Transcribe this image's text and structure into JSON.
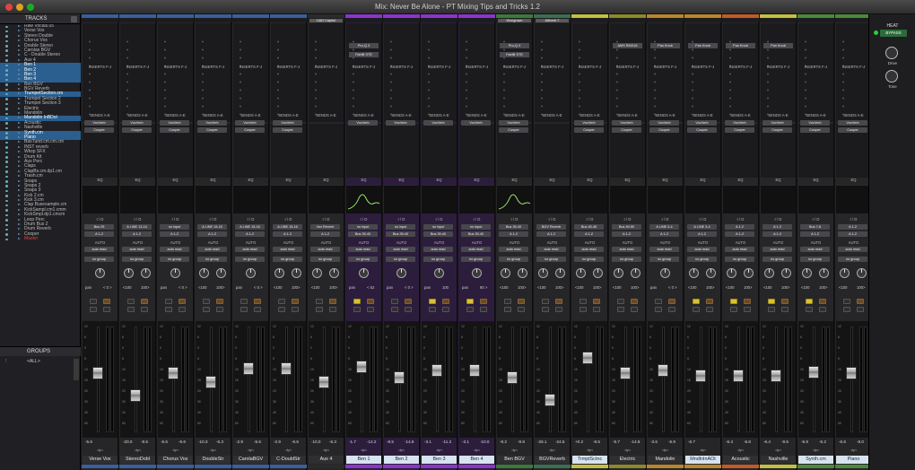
{
  "window": {
    "title": "Mix: Never Be Alone - PT Mixing Tips and Tricks 1.2"
  },
  "tracks_panel": {
    "header": "TRACKS",
    "items": [
      {
        "name": "Raw Vocals.05",
        "sel": false
      },
      {
        "name": "Verse Vox",
        "sel": false
      },
      {
        "name": "Stereo Double",
        "sel": false
      },
      {
        "name": "Chorus Vox",
        "sel": false
      },
      {
        "name": "Double Stereo",
        "sel": false
      },
      {
        "name": "Carolas BGV",
        "sel": false
      },
      {
        "name": "C - Double Stereo",
        "sel": false
      },
      {
        "name": "Aux 4",
        "sel": false
      },
      {
        "name": "Ben 1",
        "sel": true
      },
      {
        "name": "Ben 2",
        "sel": true
      },
      {
        "name": "Ben 3",
        "sel": true
      },
      {
        "name": "Ben 4",
        "sel": true
      },
      {
        "name": "Ben BGV",
        "sel": false
      },
      {
        "name": "BGV Reverb",
        "sel": false
      },
      {
        "name": "TrumpetSection.cm",
        "sel": true
      },
      {
        "name": "Trumpet Section 2",
        "sel": false
      },
      {
        "name": "Trumpet Section 3",
        "sel": false
      },
      {
        "name": "Electric",
        "sel": false
      },
      {
        "name": "Mandolin",
        "sel": false
      },
      {
        "name": "Mandolin InBDol",
        "sel": true
      },
      {
        "name": "Acoustic",
        "sel": false
      },
      {
        "name": "Nashville",
        "sel": false
      },
      {
        "name": "Synth.cm",
        "sel": true
      },
      {
        "name": "Piano",
        "sel": true
      },
      {
        "name": "BasTund.cm.cm.cm",
        "sel": false
      },
      {
        "name": "INST reverb",
        "sel": false
      },
      {
        "name": "Wksp SFX",
        "sel": false
      },
      {
        "name": "Drum Kit",
        "sel": false
      },
      {
        "name": "Aux Perc",
        "sel": false
      },
      {
        "name": "Claps",
        "sel": false
      },
      {
        "name": "ClapBs.cm.dp1.cm",
        "sel": false
      },
      {
        "name": "Trash.cm",
        "sel": false
      },
      {
        "name": "Snaps",
        "sel": false
      },
      {
        "name": "Snaps 2",
        "sel": false
      },
      {
        "name": "Snaps 3",
        "sel": false
      },
      {
        "name": "Kick 2.cm",
        "sel": false
      },
      {
        "name": "Kick 3.cm",
        "sel": false
      },
      {
        "name": "Clap Busesample.cm",
        "sel": false
      },
      {
        "name": "KickSampl.cm1.cmm",
        "sel": false
      },
      {
        "name": "KickSmpl.dp1.cmcm",
        "sel": false
      },
      {
        "name": "Loop Perc",
        "sel": false
      },
      {
        "name": "Drum Bus 2",
        "sel": false
      },
      {
        "name": "Drum Reverb",
        "sel": false
      },
      {
        "name": "Cooper",
        "sel": false
      },
      {
        "name": "Master",
        "sel": false,
        "red": true
      }
    ]
  },
  "groups_panel": {
    "header": "GROUPS",
    "items": [
      {
        "mark": "!",
        "name": "<ALL>"
      }
    ]
  },
  "labels": {
    "inserts": "INSERTS F-J",
    "sends": "SENDS A-E",
    "eq": "EQ",
    "io": "I / O",
    "auto": "AUTO",
    "no_group": "no group",
    "pan": "pan",
    "dyn": "dyn",
    "vol_default": "vol"
  },
  "strips": [
    {
      "name": "Verse Vox",
      "color": "#3a5f9e",
      "plugs": [],
      "send1": "VocVerb",
      "send2": "Cooper",
      "out": "Bus 25",
      "in": "A 1-2",
      "auto": "auto read",
      "pan_l": "pan",
      "pan_v": "< 0 >",
      "vol": "-5.6",
      "peak": "",
      "fader": 0.55,
      "sm": [
        "g",
        "o"
      ]
    },
    {
      "name": "StereoDobl",
      "color": "#3a5f9e",
      "plugs": [],
      "send1": "VocVerb",
      "send2": "Cooper",
      "out": "A LINE 13-14",
      "in": "A 1-2",
      "auto": "auto read",
      "pan_l": "<100",
      "pan_v": "100>",
      "vol": "-20.0",
      "peak": "-8.6",
      "fader": 0.3,
      "sm": [
        "g",
        "o"
      ]
    },
    {
      "name": "Chorus Vox",
      "color": "#3a5f9e",
      "plugs": [],
      "send1": "VocVerb",
      "send2": "Cooper",
      "out": "no input",
      "in": "A 1-2",
      "auto": "auto read",
      "pan_l": "pan",
      "pan_v": "< 0 >",
      "vol": "-6.6",
      "peak": "-6.6",
      "fader": 0.55,
      "sm": [
        "g",
        "o"
      ]
    },
    {
      "name": "DoubleStr",
      "color": "#3a5f9e",
      "plugs": [],
      "send1": "VocVerb",
      "send2": "Cooper",
      "out": "A LINE 15-16",
      "in": "A 1-2",
      "auto": "auto read",
      "pan_l": "<100",
      "pan_v": "100>",
      "vol": "-10.3",
      "peak": "-6.3",
      "fader": 0.45,
      "sm": [
        "g",
        "o"
      ]
    },
    {
      "name": "CarolaBGV",
      "color": "#3a5f9e",
      "plugs": [],
      "send1": "VocVerb",
      "send2": "Cooper",
      "out": "A LINE 15-16",
      "in": "A 1-2",
      "auto": "auto read",
      "pan_l": "pan",
      "pan_v": "< 0 >",
      "vol": "-2.9",
      "peak": "-5.6",
      "fader": 0.6,
      "sm": [
        "g",
        "o"
      ]
    },
    {
      "name": "C-DoublStr",
      "color": "#3a5f9e",
      "plugs": [],
      "send1": "VocVerb",
      "send2": "Cooper",
      "out": "A LINE 15-16",
      "in": "A 1-2",
      "auto": "auto read",
      "pan_l": "<100",
      "pan_v": "100>",
      "vol": "-2.9",
      "peak": "-6.5",
      "fader": 0.6,
      "sm": [
        "g",
        "o"
      ]
    },
    {
      "name": "Aux 4",
      "color": "#2b2b2b",
      "plugs": [],
      "top": "UAD Capitol",
      "send1": "",
      "send2": "",
      "out": "Vox Reverb",
      "in": "A 1-2",
      "auto": "auto read",
      "pan_l": "<100",
      "pan_v": "100>",
      "vol": "-10.0",
      "peak": "-6.3",
      "fader": 0.45,
      "sm": [
        "g",
        "o"
      ]
    },
    {
      "name": "Ben 1",
      "color": "#8a35c9",
      "hl": true,
      "sel": true,
      "plugs": [
        "Pro-Q 3",
        "Fabfilt STE"
      ],
      "send1": "VocVerb",
      "send2": "",
      "eq_curve": true,
      "out": "no input",
      "in": "Bus 39-40",
      "auto": "auto read",
      "pan_l": "pan",
      "pan_v": "< 62",
      "vol": "-1.7",
      "peak": "-12.2",
      "fader": 0.62,
      "sm": [
        "y",
        "o"
      ]
    },
    {
      "name": "Ben 2",
      "color": "#8a35c9",
      "hl": true,
      "sel": true,
      "plugs": [],
      "send1": "VocVerb",
      "send2": "",
      "out": "no input",
      "in": "Bus 39-40",
      "auto": "auto read",
      "pan_l": "pan",
      "pan_v": "< 0 >",
      "vol": "-8.5",
      "peak": "-14.8",
      "fader": 0.5,
      "sm": [
        "g",
        "o"
      ]
    },
    {
      "name": "Ben 3",
      "color": "#8a35c9",
      "hl": true,
      "sel": true,
      "plugs": [],
      "send1": "VocVerb",
      "send2": "",
      "out": "no input",
      "in": "Bus 39-40",
      "auto": "auto read",
      "pan_l": "pan",
      "pan_v": "100",
      "vol": "-3.1",
      "peak": "-11.2",
      "fader": 0.58,
      "sm": [
        "y",
        "o"
      ]
    },
    {
      "name": "Ben 4",
      "color": "#8a35c9",
      "hl": true,
      "sel": true,
      "plugs": [],
      "send1": "VocVerb",
      "send2": "",
      "out": "no input",
      "in": "Bus 39-40",
      "auto": "auto read",
      "pan_l": "pan",
      "pan_v": "80 >",
      "vol": "-3.1",
      "peak": "-10.0",
      "fader": 0.58,
      "sm": [
        "y",
        "o"
      ]
    },
    {
      "name": "Ben BGV",
      "color": "#3c7a3c",
      "plugs": [
        "Pro-Q 3",
        "Fabfilt STE"
      ],
      "top": "Wongrown",
      "send1": "VocVerb",
      "send2": "Cooper",
      "eq_curve": true,
      "out": "Bus 39-40",
      "in": "A 1-2",
      "auto": "auto read",
      "pan_l": "<100",
      "pan_v": "100>",
      "vol": "-8.2",
      "peak": "-9.8",
      "fader": 0.5,
      "sm": [
        "g",
        "o"
      ]
    },
    {
      "name": "BGVReverb",
      "color": "#3a6f52",
      "plugs": [],
      "top": "Altiverb 7",
      "send1": "",
      "send2": "",
      "out": "BGV Reverb",
      "in": "A 1-2",
      "auto": "auto read",
      "pan_l": "<100",
      "pan_v": "100>",
      "vol": "-26.1",
      "peak": "-24.5",
      "fader": 0.25,
      "sm": [
        "g",
        "o"
      ]
    },
    {
      "name": "TrmptSctnc",
      "color": "#c2c040",
      "sel": true,
      "plugs": [],
      "send1": "VocVerb",
      "send2": "Cooper",
      "out": "Bus 45-46",
      "in": "A 1-2",
      "auto": "auto read",
      "pan_l": "<100",
      "pan_v": "100>",
      "vol": "+0.2",
      "peak": "-8.5",
      "fader": 0.72,
      "sm": [
        "g",
        "o"
      ]
    },
    {
      "name": "Electric",
      "color": "#8a8a2a",
      "plugs": [
        "AMS RMX16"
      ],
      "send1": "VocVerb",
      "send2": "Cooper",
      "out": "Bus 49-50",
      "in": "A 1-2",
      "auto": "auto read",
      "pan_l": "<100",
      "pan_v": "100>",
      "vol": "-5.7",
      "peak": "-14.8",
      "fader": 0.55,
      "sm": [
        "g",
        "o"
      ]
    },
    {
      "name": "Mandolin",
      "color": "#b9872a",
      "plugs": [
        "Pan Knob"
      ],
      "send1": "VocVerb",
      "send2": "Cooper",
      "out": "A LINE 3-4",
      "in": "A 1-2",
      "auto": "auto read",
      "pan_l": "pan",
      "pan_v": "< 0 >",
      "vol": "-3.6",
      "peak": "-6.9",
      "fader": 0.58,
      "sm": [
        "g",
        "o"
      ]
    },
    {
      "name": "MndlnInAOt",
      "color": "#b9872a",
      "sel": true,
      "plugs": [
        "Pan Knob"
      ],
      "send1": "VocVerb",
      "send2": "Cooper",
      "out": "A LINE 3-4",
      "in": "A 1-2",
      "auto": "auto read",
      "pan_l": "<100",
      "pan_v": "100>",
      "vol": "-6.7",
      "peak": "",
      "fader": 0.52,
      "sm": [
        "y",
        "o"
      ]
    },
    {
      "name": "Acoustic",
      "color": "#c25a2a",
      "plugs": [
        "Pan Knob"
      ],
      "send1": "VocVerb",
      "send2": "Cooper",
      "out": "A 1-2",
      "in": "A 1-2",
      "auto": "auto read",
      "pan_l": "<100",
      "pan_v": "100>",
      "vol": "-6.4",
      "peak": "-6.8",
      "fader": 0.52,
      "sm": [
        "y",
        "o"
      ]
    },
    {
      "name": "Nashville",
      "color": "#c2c040",
      "plugs": [
        "Pan Knob"
      ],
      "send1": "VocVerb",
      "send2": "Cooper",
      "out": "A 1-2",
      "in": "A 1-2",
      "auto": "auto read",
      "pan_l": "<100",
      "pan_v": "100>",
      "vol": "-6.4",
      "peak": "-9.5",
      "fader": 0.52,
      "sm": [
        "y",
        "o"
      ]
    },
    {
      "name": "Synth.cm",
      "color": "#4a8a3a",
      "sel": true,
      "plugs": [],
      "send1": "VocVerb",
      "send2": "Cooper",
      "out": "Bus 7-8",
      "in": "A 1-2",
      "auto": "auto read",
      "pan_l": "<100",
      "pan_v": "100>",
      "vol": "-5.9",
      "peak": "-5.2",
      "fader": 0.56,
      "sm": [
        "y",
        "o"
      ]
    },
    {
      "name": "Piano",
      "color": "#4a8a3a",
      "sel": true,
      "plugs": [],
      "send1": "VocVerb",
      "send2": "Cooper",
      "out": "A 1-2",
      "in": "A 1-2",
      "auto": "auto read",
      "pan_l": "<100",
      "pan_v": "100>",
      "vol": "-6.6",
      "peak": "-8.0",
      "fader": 0.55,
      "sm": [
        "g",
        "o"
      ]
    }
  ],
  "right_panel": {
    "heat": "HEAT",
    "bypass": "BYPASS",
    "knob1": "Drive",
    "knob2": "Tone"
  }
}
